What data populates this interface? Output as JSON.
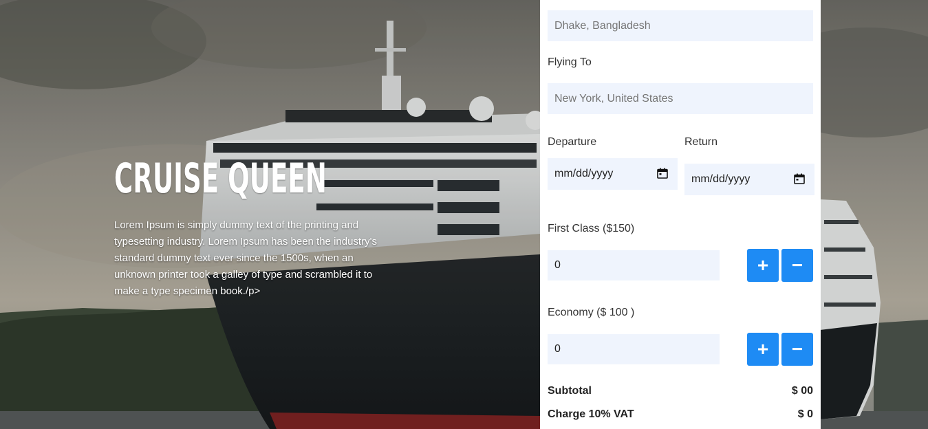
{
  "hero": {
    "title": "CRUISE QUEEN",
    "description": "Lorem Ipsum is simply dummy text of the printing and typesetting industry. Lorem Ipsum has been the industry's standard dummy text ever since the 1500s, when an unknown printer took a galley of type and scrambled it to make a type specimen book./p>"
  },
  "form": {
    "flying_from_placeholder": "Dhake, Bangladesh",
    "flying_to_label": "Flying To",
    "flying_to_placeholder": "New York, United States",
    "departure_label": "Departure",
    "return_label": "Return",
    "date_placeholder": "mm/dd/yyyy",
    "first_class_label": "First Class ($150)",
    "first_class_qty": "0",
    "economy_label": "Economy ($ 100 )",
    "economy_qty": "0",
    "plus": "+",
    "minus": "−",
    "subtotal_label": "Subtotal",
    "subtotal_value": "$ 00",
    "vat_label": "Charge 10% VAT",
    "vat_value": "$ 0"
  },
  "colors": {
    "accent": "#1e8bf4",
    "field_bg": "#eff4fd"
  },
  "icons": [
    "calendar-icon",
    "plus-icon",
    "minus-icon"
  ]
}
